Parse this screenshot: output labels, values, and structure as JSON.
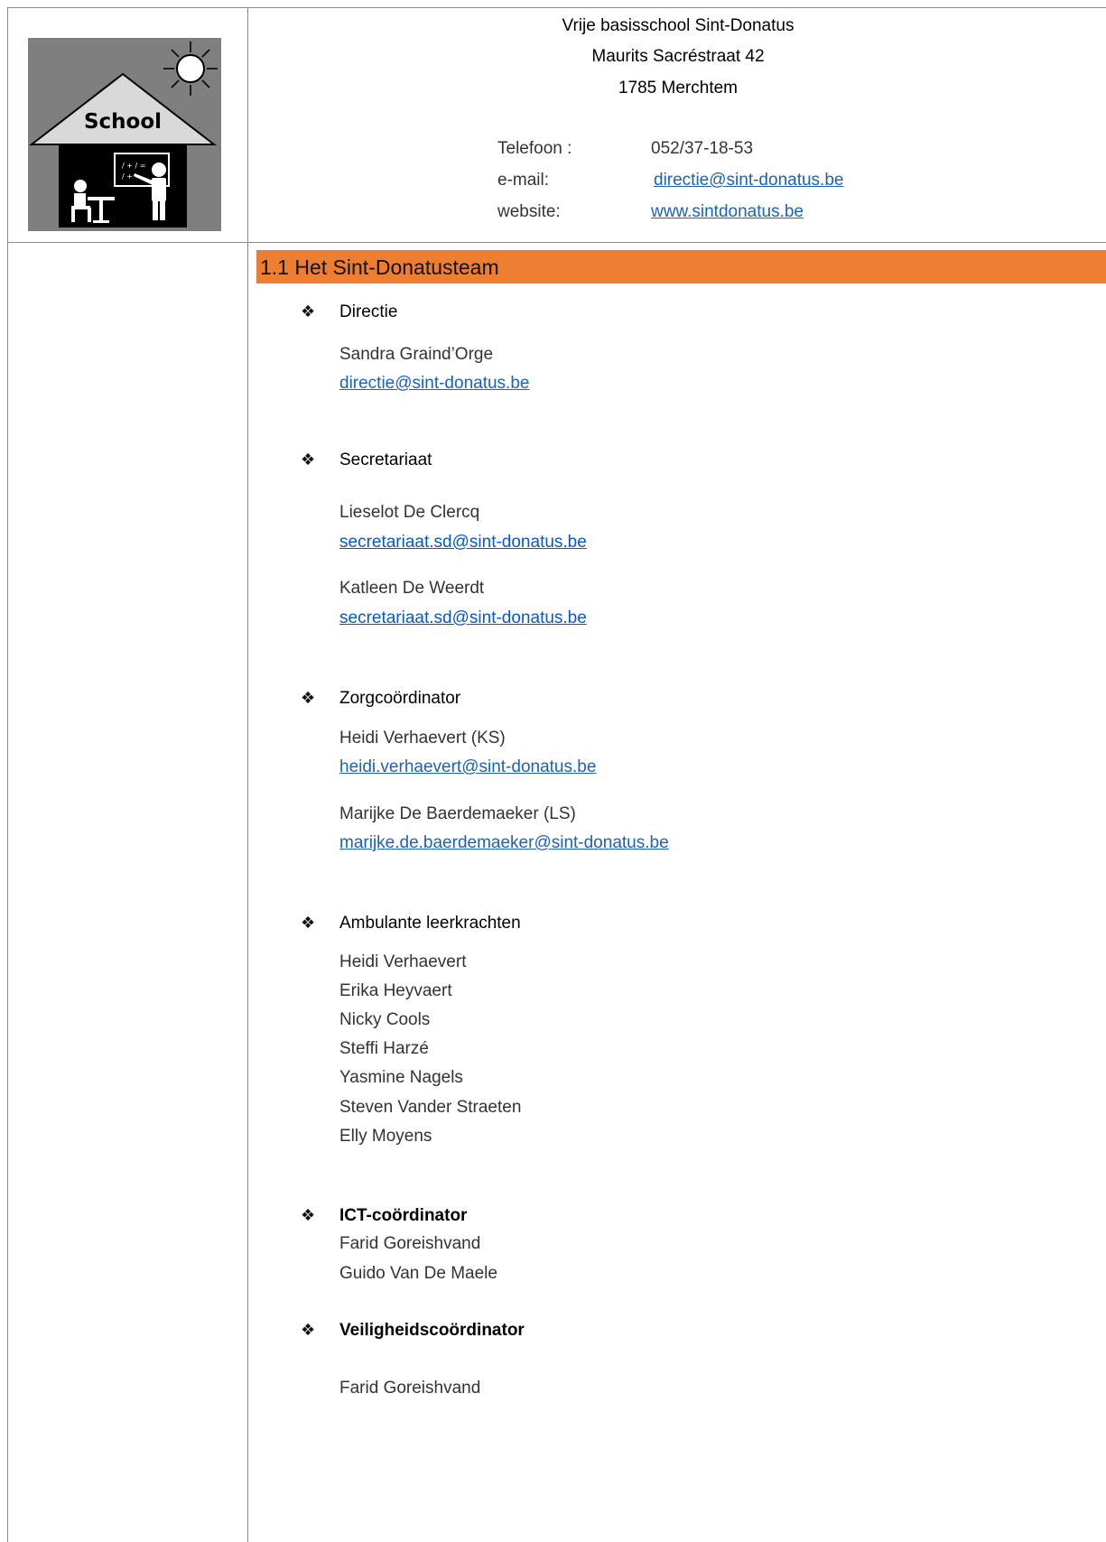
{
  "header": {
    "school_name": "Vrije basisschool Sint-Donatus",
    "street": "Maurits Sacréstraat 42",
    "city": "1785 Merchtem",
    "logo_text": "School",
    "contact": {
      "phone_label": "Telefoon :",
      "phone_value": "052/37-18-53",
      "email_label": "e-mail:",
      "email_value": "directie@sint-donatus.be",
      "website_label": "website:",
      "website_value": "www.sintdonatus.be"
    }
  },
  "section": {
    "title": "1.1 Het Sint-Donatusteam",
    "bullet_glyph": "❖",
    "color": "#ed7d31"
  },
  "groups": {
    "directie": {
      "heading": "Directie",
      "people": [
        {
          "name": "Sandra Graind’Orge",
          "email": "directie@sint-donatus.be"
        }
      ]
    },
    "secretariaat": {
      "heading": "Secretariaat",
      "people": [
        {
          "name": "Lieselot De Clercq",
          "email": "secretariaat.sd@sint-donatus.be"
        },
        {
          "name": "Katleen De Weerdt",
          "email": "secretariaat.sd@sint-donatus.be"
        }
      ]
    },
    "zorg": {
      "heading": "Zorgcoördinator",
      "people": [
        {
          "name": "Heidi Verhaevert (KS)",
          "email": "heidi.verhaevert@sint-donatus.be"
        },
        {
          "name": "Marijke De Baerdemaeker (LS)",
          "email": "marijke.de.baerdemaeker@sint-donatus.be"
        }
      ]
    },
    "ambulant": {
      "heading": "Ambulante leerkrachten",
      "names": [
        "Heidi Verhaevert",
        "Erika Heyvaert",
        "Nicky Cools",
        "Steffi Harzé",
        "Yasmine Nagels",
        "Steven Vander Straeten",
        "Elly Moyens"
      ]
    },
    "ict": {
      "heading": "ICT-coördinator",
      "names": [
        "Farid Goreishvand",
        "Guido Van De Maele"
      ]
    },
    "veiligheid": {
      "heading": "Veiligheidscoördinator",
      "names": [
        "Farid Goreishvand"
      ]
    }
  }
}
